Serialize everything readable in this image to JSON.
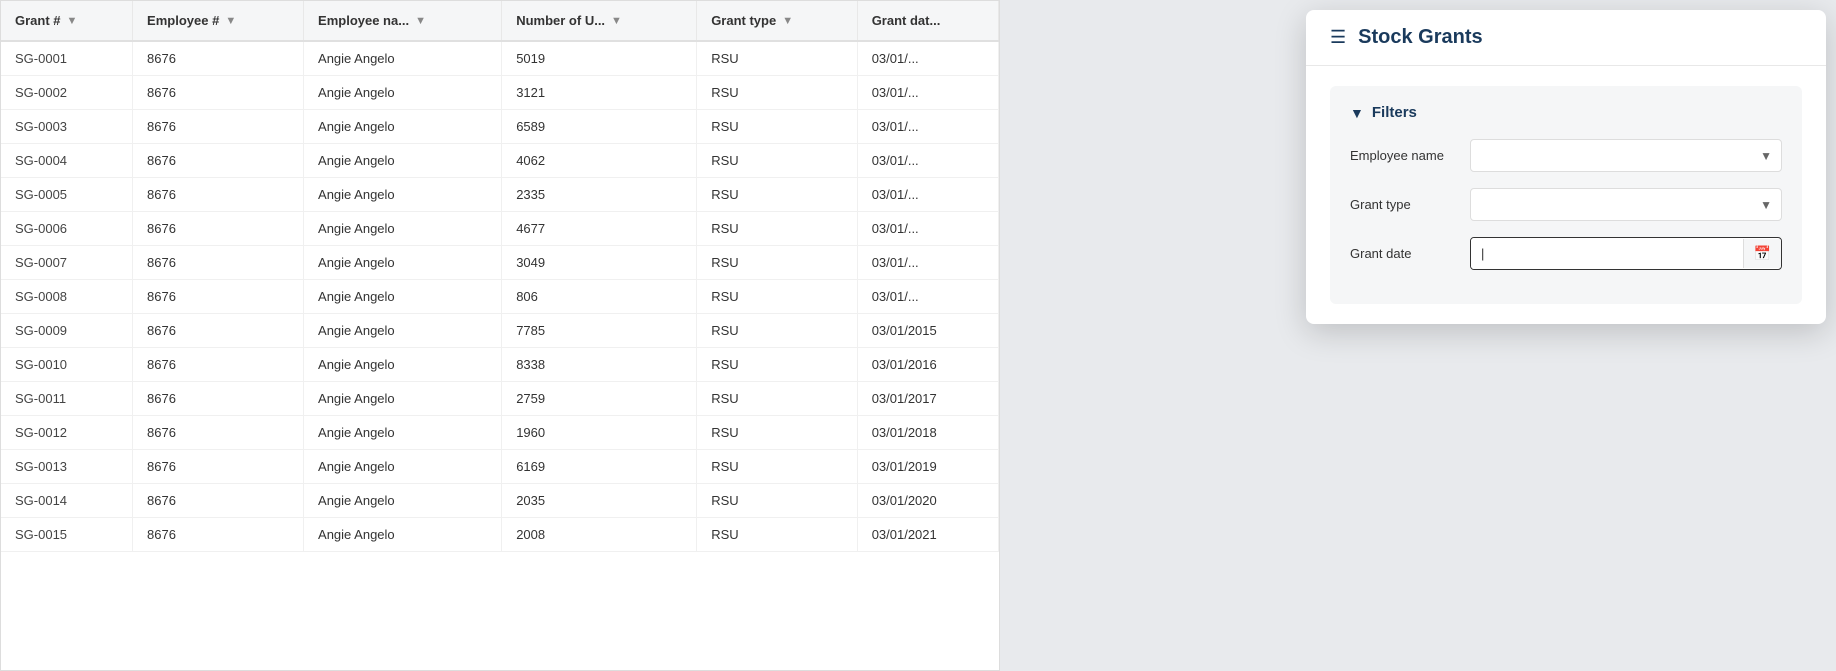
{
  "panel": {
    "title": "Stock Grants",
    "filters_label": "Filters",
    "filter_employee_name_label": "Employee name",
    "filter_employee_name_value": "",
    "filter_grant_type_label": "Grant type",
    "filter_grant_type_value": "",
    "filter_grant_date_label": "Grant date",
    "filter_grant_date_value": ""
  },
  "table": {
    "columns": [
      {
        "id": "grant_num",
        "label": "Grant #"
      },
      {
        "id": "employee_num",
        "label": "Employee #"
      },
      {
        "id": "employee_name",
        "label": "Employee na..."
      },
      {
        "id": "number_of_u",
        "label": "Number of U..."
      },
      {
        "id": "grant_type",
        "label": "Grant type"
      },
      {
        "id": "grant_date",
        "label": "Grant dat..."
      }
    ],
    "rows": [
      {
        "grant_num": "SG-0001",
        "employee_num": "8676",
        "employee_name": "Angie Angelo",
        "number_of_u": "5019",
        "grant_type": "RSU",
        "grant_date": "03/01/..."
      },
      {
        "grant_num": "SG-0002",
        "employee_num": "8676",
        "employee_name": "Angie Angelo",
        "number_of_u": "3121",
        "grant_type": "RSU",
        "grant_date": "03/01/..."
      },
      {
        "grant_num": "SG-0003",
        "employee_num": "8676",
        "employee_name": "Angie Angelo",
        "number_of_u": "6589",
        "grant_type": "RSU",
        "grant_date": "03/01/..."
      },
      {
        "grant_num": "SG-0004",
        "employee_num": "8676",
        "employee_name": "Angie Angelo",
        "number_of_u": "4062",
        "grant_type": "RSU",
        "grant_date": "03/01/..."
      },
      {
        "grant_num": "SG-0005",
        "employee_num": "8676",
        "employee_name": "Angie Angelo",
        "number_of_u": "2335",
        "grant_type": "RSU",
        "grant_date": "03/01/..."
      },
      {
        "grant_num": "SG-0006",
        "employee_num": "8676",
        "employee_name": "Angie Angelo",
        "number_of_u": "4677",
        "grant_type": "RSU",
        "grant_date": "03/01/..."
      },
      {
        "grant_num": "SG-0007",
        "employee_num": "8676",
        "employee_name": "Angie Angelo",
        "number_of_u": "3049",
        "grant_type": "RSU",
        "grant_date": "03/01/..."
      },
      {
        "grant_num": "SG-0008",
        "employee_num": "8676",
        "employee_name": "Angie Angelo",
        "number_of_u": "806",
        "grant_type": "RSU",
        "grant_date": "03/01/..."
      },
      {
        "grant_num": "SG-0009",
        "employee_num": "8676",
        "employee_name": "Angie Angelo",
        "number_of_u": "7785",
        "grant_type": "RSU",
        "grant_date": "03/01/2015"
      },
      {
        "grant_num": "SG-0010",
        "employee_num": "8676",
        "employee_name": "Angie Angelo",
        "number_of_u": "8338",
        "grant_type": "RSU",
        "grant_date": "03/01/2016"
      },
      {
        "grant_num": "SG-0011",
        "employee_num": "8676",
        "employee_name": "Angie Angelo",
        "number_of_u": "2759",
        "grant_type": "RSU",
        "grant_date": "03/01/2017"
      },
      {
        "grant_num": "SG-0012",
        "employee_num": "8676",
        "employee_name": "Angie Angelo",
        "number_of_u": "1960",
        "grant_type": "RSU",
        "grant_date": "03/01/2018"
      },
      {
        "grant_num": "SG-0013",
        "employee_num": "8676",
        "employee_name": "Angie Angelo",
        "number_of_u": "6169",
        "grant_type": "RSU",
        "grant_date": "03/01/2019"
      },
      {
        "grant_num": "SG-0014",
        "employee_num": "8676",
        "employee_name": "Angie Angelo",
        "number_of_u": "2035",
        "grant_type": "RSU",
        "grant_date": "03/01/2020"
      },
      {
        "grant_num": "SG-0015",
        "employee_num": "8676",
        "employee_name": "Angie Angelo",
        "number_of_u": "2008",
        "grant_type": "RSU",
        "grant_date": "03/01/2021"
      }
    ]
  }
}
